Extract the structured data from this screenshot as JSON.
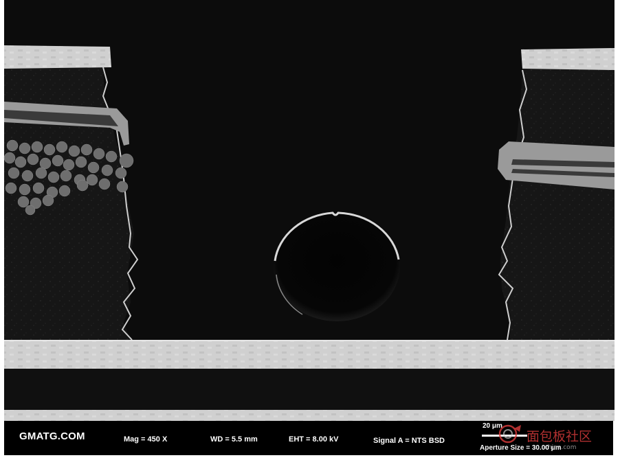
{
  "image": {
    "description": "SEM cross-section of PCB showing through-hole between two copper layers",
    "watermark": {
      "icon": "electronics-forum-logo",
      "text": "面包板社区",
      "domain": "china.com"
    }
  },
  "info_bar": {
    "organization": "GMATG.COM",
    "mag": "Mag =   450 X",
    "wd": "WD =  5.5 mm",
    "eht": "EHT =  8.00 kV",
    "signal": "Signal A = NTS BSD",
    "scale_label": "20 μm",
    "aperture": "Aperture Size = 30.00 μm"
  },
  "colors": {
    "background": "#0c0c0c",
    "copper": "#d2d2d2",
    "resin": "#141414",
    "fiber": "#6e6e6e"
  }
}
